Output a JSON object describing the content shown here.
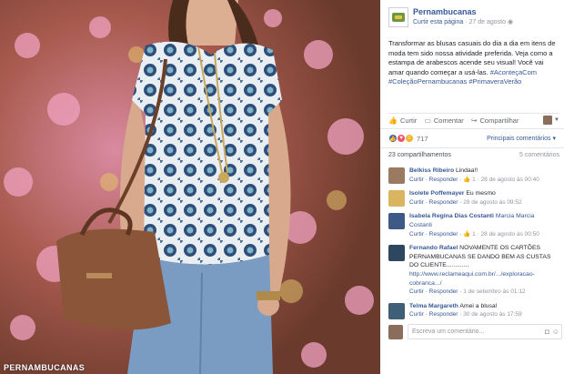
{
  "photo": {
    "watermark": "PERNAMBUCANAS"
  },
  "header": {
    "page_name": "Pernambucanas",
    "like_page": "Curtir esta página",
    "separator": "·",
    "date": "27 de agosto",
    "globe_icon": "globe-icon"
  },
  "post": {
    "text": "Transformar as blusas casuais do dia a dia em itens de moda tem sido nossa atividade preferida. Veja como a estampa de arabescos acende seu visual! Você vai amar quando começar a usá-las.",
    "hashtags": "#AconteçaCom #ColeçãoPernambucanas #PrimaveraVerão"
  },
  "actions": {
    "like": "Curtir",
    "comment": "Comentar",
    "share": "Compartilhar"
  },
  "reactions": {
    "count": "717",
    "top_comments": "Principais comentários"
  },
  "stats": {
    "shares": "23 compartilhamentos",
    "comments": "5 comentários"
  },
  "comments": [
    {
      "author": "Belkiss Ribeiro",
      "text": "Lindaa!!",
      "reply": "Curtir · Responder · ",
      "likes": "1",
      "time": " · 28 de agosto às 00:40",
      "color": "#9b7a62"
    },
    {
      "author": "Isolete Poffemayer",
      "text": "Eu mesmo",
      "reply": "Curtir · Responder · ",
      "likes": "",
      "time": "28 de agosto às 09:52",
      "color": "#d9b560"
    },
    {
      "author": "Isabela Regina Dias Costanti",
      "text": "Marcia Marcia Costanti",
      "reply": "Curtir · Responder · ",
      "likes": "1",
      "time": " · 28 de agosto às 00:50",
      "color": "#3d5a86"
    },
    {
      "author": "Fernando Rafael",
      "text": "NOVAMENTE OS CARTÕES PERNAMBUCANAS SE DANDO BEM AS CUSTAS DO CLIENTE.............",
      "link": "http://www.reclameaqui.com.br/.../exploracao-cobranca.../",
      "reply": "Curtir · Responder · ",
      "likes": "",
      "time": "1 de setembro às 01:12",
      "color": "#2f4660"
    },
    {
      "author": "Telma Margareth",
      "text": "Amei a blusa!",
      "reply": "Curtir · Responder · ",
      "likes": "",
      "time": "30 de agosto às 17:59",
      "color": "#3f5e78"
    }
  ],
  "reply": {
    "placeholder": "Escreva um comentário...",
    "camera_icon": "camera-icon",
    "emoji_icon": "emoji-icon"
  }
}
